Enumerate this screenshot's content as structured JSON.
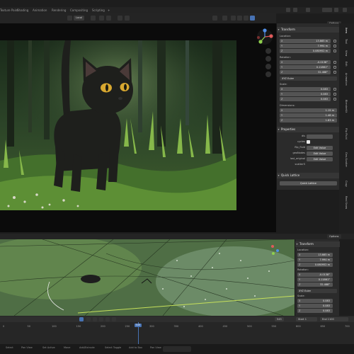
{
  "topbar": {
    "tabs": [
      {
        "label": "Texture Paint",
        "active": false
      },
      {
        "label": "Shading",
        "active": false
      },
      {
        "label": "Animation",
        "active": false
      },
      {
        "label": "Rendering",
        "active": false
      },
      {
        "label": "Compositing",
        "active": false
      },
      {
        "label": "Scripting",
        "active": false
      },
      {
        "label": "+",
        "active": false
      }
    ]
  },
  "header": {
    "transform_orientation": "Local",
    "options_label": "Options"
  },
  "npanel": {
    "transform_title": "Transform",
    "location_label": "Location:",
    "location": [
      {
        "axis": "X",
        "value": "13.665 m"
      },
      {
        "axis": "Y",
        "value": "7.994 m"
      },
      {
        "axis": "Z",
        "value": "0.080952 m"
      }
    ],
    "rotation_label": "Rotation:",
    "rotation": [
      {
        "axis": "X",
        "value": "-0.0138°"
      },
      {
        "axis": "Y",
        "value": "0.11861°"
      },
      {
        "axis": "Z",
        "value": "32.488°"
      }
    ],
    "rotation_mode": "XYZ Euler",
    "scale_label": "Scale:",
    "scale": [
      {
        "axis": "X",
        "value": "0.083"
      },
      {
        "axis": "Y",
        "value": "0.083"
      },
      {
        "axis": "Z",
        "value": "0.083"
      }
    ],
    "dimensions_label": "Dimensions:",
    "dimensions": [
      {
        "axis": "X",
        "value": "1.15 m"
      },
      {
        "axis": "Y",
        "value": "1.48 m"
      },
      {
        "axis": "Z",
        "value": "1.83 m"
      }
    ],
    "properties_title": "Properties",
    "properties": [
      {
        "name": "dis",
        "kind": "field",
        "value": ""
      },
      {
        "name": "cycles",
        "kind": "checkbox",
        "value": ""
      },
      {
        "name": "flip_fluid",
        "kind": "button",
        "value": "Edit Value"
      },
      {
        "name": "geoNodes",
        "kind": "button",
        "value": "Edit Value"
      },
      {
        "name": "last_original",
        "kind": "button",
        "value": "Edit Value"
      },
      {
        "name": "scatter5",
        "kind": "label",
        "value": ""
      }
    ],
    "quick_lattice_title": "Quick Lattice",
    "quick_lattice_button": "Quick Lattice"
  },
  "sidetabs": [
    "Item",
    "Tool",
    "View",
    "Edit",
    "Animation",
    "BlenderKit",
    "Flip Fluid",
    "Geo-Scatter",
    "Copy",
    "Real Snow"
  ],
  "npanel2": {
    "transform_title": "Transform",
    "location_label": "Location:",
    "location": [
      {
        "axis": "X",
        "value": "13.665 m"
      },
      {
        "axis": "Y",
        "value": "7.994 m"
      },
      {
        "axis": "Z",
        "value": "0.080952 m"
      }
    ],
    "rotation_label": "Rotation:",
    "rotation": [
      {
        "axis": "X",
        "value": "-0.0138°"
      },
      {
        "axis": "Y",
        "value": "0.11861°"
      },
      {
        "axis": "Z",
        "value": "32.488°"
      }
    ],
    "rotation_mode": "XYZ Euler",
    "scale_label": "Scale:",
    "scale": [
      {
        "axis": "X",
        "value": "0.083"
      },
      {
        "axis": "Y",
        "value": "0.083"
      },
      {
        "axis": "Z",
        "value": "0.083"
      }
    ]
  },
  "timeline": {
    "current_frame": "545",
    "start_label": "Start",
    "start": "1",
    "end_label": "End",
    "end": "1100",
    "ticks": [
      "0",
      "50",
      "100",
      "150",
      "200",
      "250",
      "300",
      "350",
      "400",
      "450",
      "500",
      "550",
      "600",
      "650",
      "700"
    ]
  },
  "statusbar": {
    "items": [
      "Select",
      "Pan View",
      "Set Active",
      "Move",
      "Add/Extrude",
      "Select Toggle",
      "Add to Box",
      "Pan View"
    ]
  },
  "colors": {
    "accent_blue": "#4772b3",
    "panel": "#2b2b2b",
    "field": "#545454",
    "x_axis": "#e05a5a",
    "y_axis": "#8fd04d",
    "z_axis": "#4f8ee6"
  }
}
